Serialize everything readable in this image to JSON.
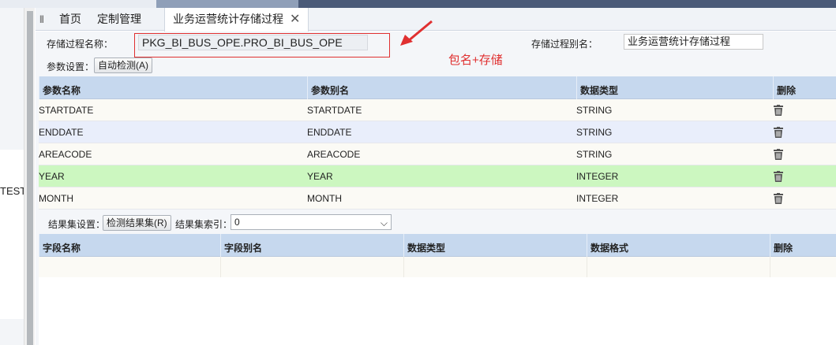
{
  "tabs": [
    {
      "label": "首页"
    },
    {
      "label": "定制管理"
    },
    {
      "label": "业务运营统计存储过程",
      "close": "✕"
    }
  ],
  "left_panel_text": "TEST",
  "form": {
    "proc_name_label": "存储过程名称：",
    "proc_name_value": "PKG_BI_BUS_OPE.PRO_BI_BUS_OPE",
    "proc_alias_label": "存储过程别名：",
    "proc_alias_value": "业务运营统计存储过程",
    "param_settings_label": "参数设置：",
    "auto_detect_button": "自动检测(A)",
    "annotation_text": "包名+存储"
  },
  "params_grid": {
    "headers": [
      "参数名称",
      "参数别名",
      "数据类型",
      "删除"
    ],
    "rows": [
      [
        "STARTDATE",
        "STARTDATE",
        "STRING"
      ],
      [
        "ENDDATE",
        "ENDDATE",
        "STRING"
      ],
      [
        "AREACODE",
        "AREACODE",
        "STRING"
      ],
      [
        "YEAR",
        "YEAR",
        "INTEGER"
      ],
      [
        "MONTH",
        "MONTH",
        "INTEGER"
      ]
    ],
    "selected_row": 3
  },
  "result_settings": {
    "label": "结果集设置：",
    "detect_button": "检测结果集(R)",
    "index_label": "结果集索引：",
    "index_value": "0"
  },
  "fields_grid": {
    "headers": [
      "字段名称",
      "字段别名",
      "数据类型",
      "数据格式",
      "删除"
    ]
  },
  "colors": {
    "header_bg": "#c6d8ee",
    "selected_row": "#ccf7c0",
    "annotation_red": "#e03030",
    "topbar": "#4a5a78"
  },
  "icons": [
    "trash-icon",
    "close-icon",
    "chevron-down-icon",
    "arrow-annotation-icon",
    "tab-grip-icon"
  ]
}
